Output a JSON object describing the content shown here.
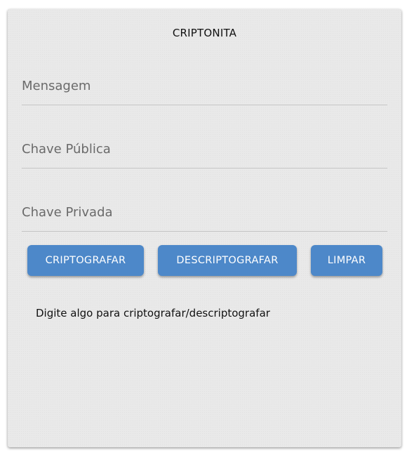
{
  "app": {
    "title": "CRIPTONITA"
  },
  "form": {
    "message": {
      "placeholder": "Mensagem",
      "value": ""
    },
    "public_key": {
      "placeholder": "Chave Pública",
      "value": ""
    },
    "private_key": {
      "placeholder": "Chave Privada",
      "value": ""
    }
  },
  "actions": {
    "encrypt_label": "CRIPTOGRAFAR",
    "decrypt_label": "DESCRIPTOGRAFAR",
    "clear_label": "LIMPAR"
  },
  "status": {
    "text": "Digite algo para criptografar/descriptografar"
  },
  "colors": {
    "button": "#4d88c9",
    "card": "#e9e9e9",
    "divider": "#c4c4c4"
  }
}
